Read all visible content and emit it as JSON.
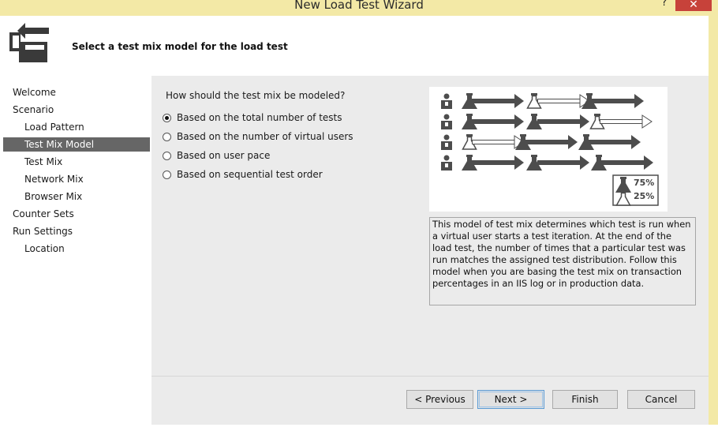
{
  "window": {
    "title": "New Load Test Wizard",
    "help_label": "?",
    "close_label": "✕"
  },
  "header": {
    "title": "Select a test mix model for the load test",
    "icon": "wizard-icon"
  },
  "nav": {
    "items": [
      {
        "label": "Welcome"
      },
      {
        "label": "Scenario"
      },
      {
        "label": "Load Pattern"
      },
      {
        "label": "Test Mix Model"
      },
      {
        "label": "Test Mix"
      },
      {
        "label": "Network Mix"
      },
      {
        "label": "Browser Mix"
      },
      {
        "label": "Counter Sets"
      },
      {
        "label": "Run Settings"
      },
      {
        "label": "Location"
      }
    ],
    "selected": "Test Mix Model"
  },
  "main": {
    "question": "How should the test mix be modeled?",
    "options": [
      {
        "label": "Based on the total number of tests",
        "selected": true
      },
      {
        "label": "Based on the number of virtual users",
        "selected": false
      },
      {
        "label": "Based on user pace",
        "selected": false
      },
      {
        "label": "Based on sequential test order",
        "selected": false
      }
    ],
    "legend": {
      "solid": "75%",
      "outline": "25%"
    },
    "description": "This model of test mix determines which test is run when a virtual user starts a test iteration. At the end of the load test, the number of times that a particular test was run matches the assigned test distribution. Follow this model when you are basing the test mix on transaction percentages in an IIS log or in production data."
  },
  "footer": {
    "previous": "< Previous",
    "next": "Next >",
    "finish": "Finish",
    "cancel": "Cancel"
  },
  "colors": {
    "titlebar": "#f3e9a6",
    "close": "#c7423a",
    "selection": "#666666",
    "panel": "#ebebeb"
  }
}
